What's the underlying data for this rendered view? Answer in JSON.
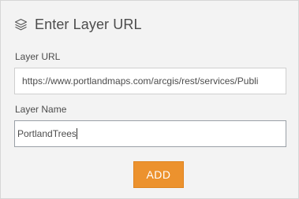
{
  "dialog": {
    "title": "Enter Layer URL",
    "title_icon": "layers-icon"
  },
  "fields": {
    "url": {
      "label": "Layer URL",
      "value": "https://www.portlandmaps.com/arcgis/rest/services/Publi"
    },
    "name": {
      "label": "Layer Name",
      "value": "PortlandTrees"
    }
  },
  "actions": {
    "add_label": "ADD"
  },
  "colors": {
    "accent": "#ec922e",
    "text": "#4c4c4c",
    "panel_bg": "#f3f3f3"
  }
}
